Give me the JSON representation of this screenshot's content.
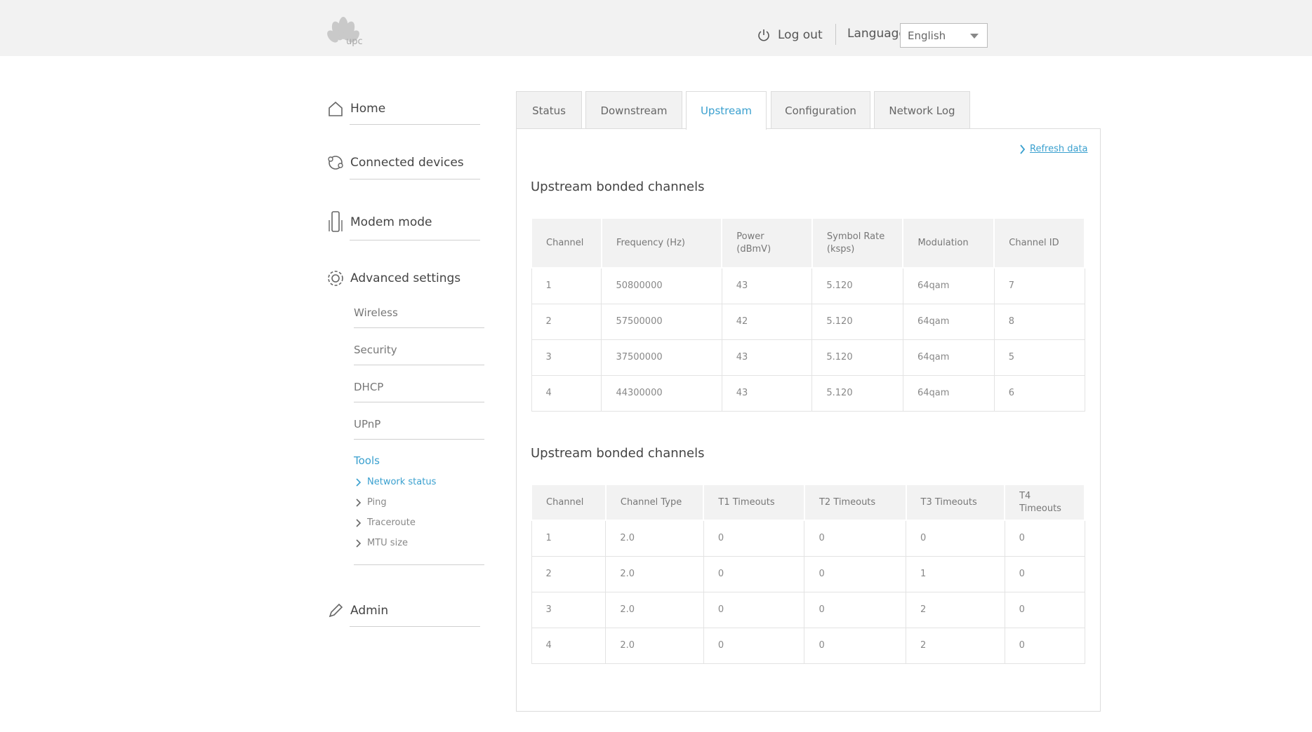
{
  "brand": {
    "logo_text": "upc"
  },
  "header": {
    "logout_label": "Log out",
    "language_label": "Language",
    "language_value": "English"
  },
  "sidebar": {
    "home": "Home",
    "connected_devices": "Connected devices",
    "modem_mode": "Modem mode",
    "advanced_settings": "Advanced settings",
    "sub_items": [
      "Wireless",
      "Security",
      "DHCP",
      "UPnP"
    ],
    "tools": "Tools",
    "tool_items": [
      "Network status",
      "Ping",
      "Traceroute",
      "MTU size"
    ],
    "admin": "Admin"
  },
  "tabs": [
    "Status",
    "Downstream",
    "Upstream",
    "Configuration",
    "Network Log"
  ],
  "refresh_label": "Refresh data",
  "section1": {
    "title": "Upstream bonded channels",
    "headers": [
      "Channel",
      "Frequency (Hz)",
      "Power\n(dBmV)",
      "Symbol Rate\n(ksps)",
      "Modulation",
      "Channel ID"
    ],
    "rows": [
      [
        "1",
        "50800000",
        "43",
        "5.120",
        "64qam",
        "7"
      ],
      [
        "2",
        "57500000",
        "42",
        "5.120",
        "64qam",
        "8"
      ],
      [
        "3",
        "37500000",
        "43",
        "5.120",
        "64qam",
        "5"
      ],
      [
        "4",
        "44300000",
        "43",
        "5.120",
        "64qam",
        "6"
      ]
    ]
  },
  "section2": {
    "title": "Upstream bonded channels",
    "headers": [
      "Channel",
      "Channel Type",
      "T1 Timeouts",
      "T2 Timeouts",
      "T3 Timeouts",
      "T4 Timeouts"
    ],
    "rows": [
      [
        "1",
        "2.0",
        "0",
        "0",
        "0",
        "0"
      ],
      [
        "2",
        "2.0",
        "0",
        "0",
        "1",
        "0"
      ],
      [
        "3",
        "2.0",
        "0",
        "0",
        "2",
        "0"
      ],
      [
        "4",
        "2.0",
        "0",
        "0",
        "2",
        "0"
      ]
    ]
  },
  "colors": {
    "accent": "#3aa0cf",
    "header_bg": "#f2f2f2"
  }
}
